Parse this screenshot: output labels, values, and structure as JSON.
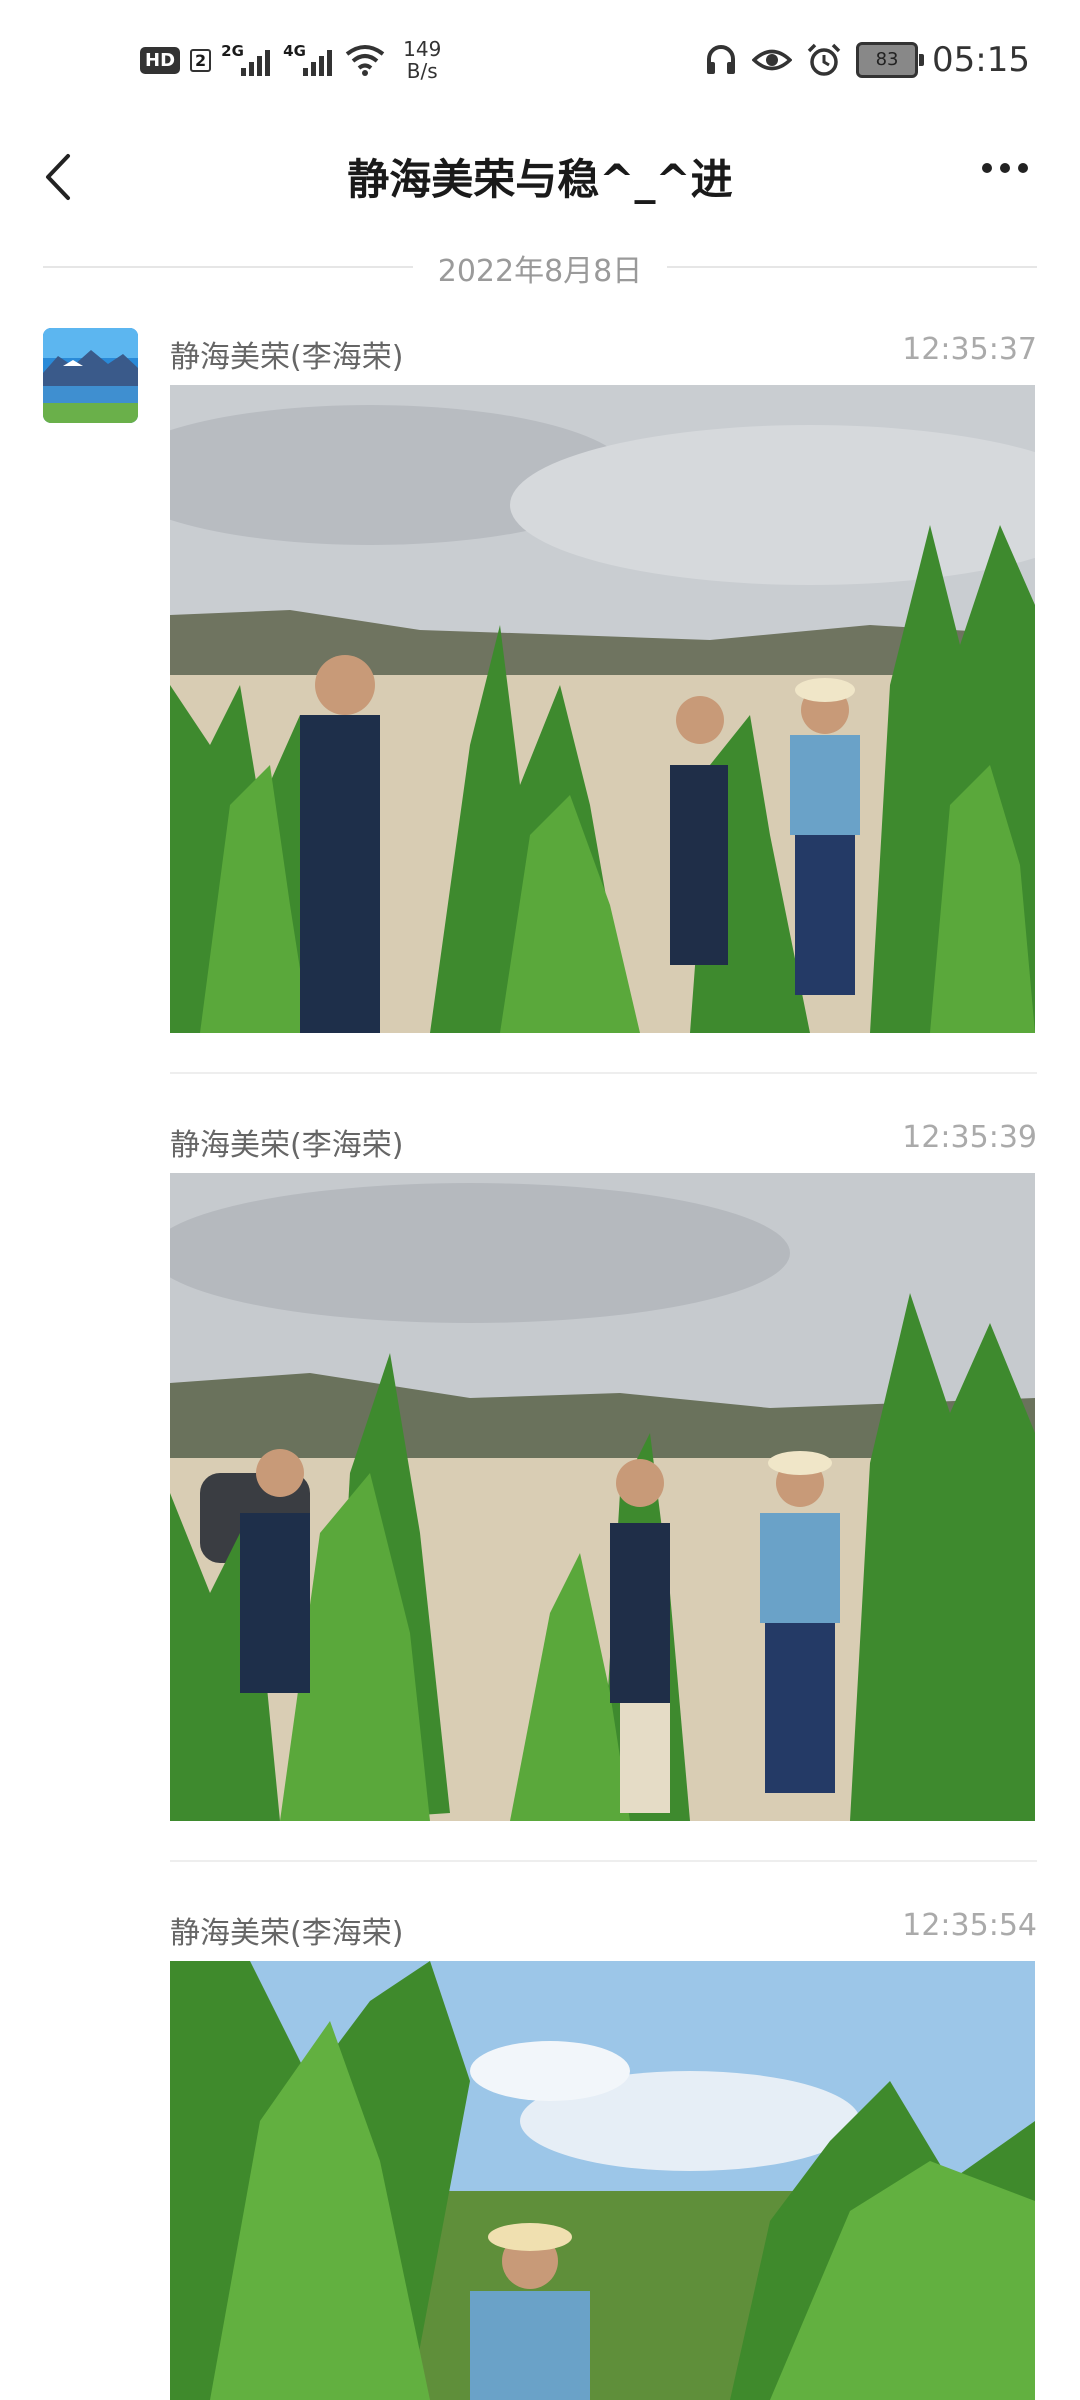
{
  "status_bar": {
    "hd": "HD",
    "sim": "2",
    "net1": "2G",
    "net2": "4G",
    "speed_value": "149",
    "speed_unit": "B/s",
    "battery": "83",
    "time": "05:15"
  },
  "header": {
    "title": "静海美荣与稳^_^进"
  },
  "date_divider": "2022年8月8日",
  "messages": [
    {
      "sender": "静海美荣(李海荣)",
      "time": "12:35:37",
      "photo": "cornfield-photo"
    },
    {
      "sender": "静海美荣(李海荣)",
      "time": "12:35:39",
      "photo": "cornfield-photo"
    },
    {
      "sender": "静海美荣(李海荣)",
      "time": "12:35:54",
      "photo": "cornfield-photo"
    }
  ]
}
